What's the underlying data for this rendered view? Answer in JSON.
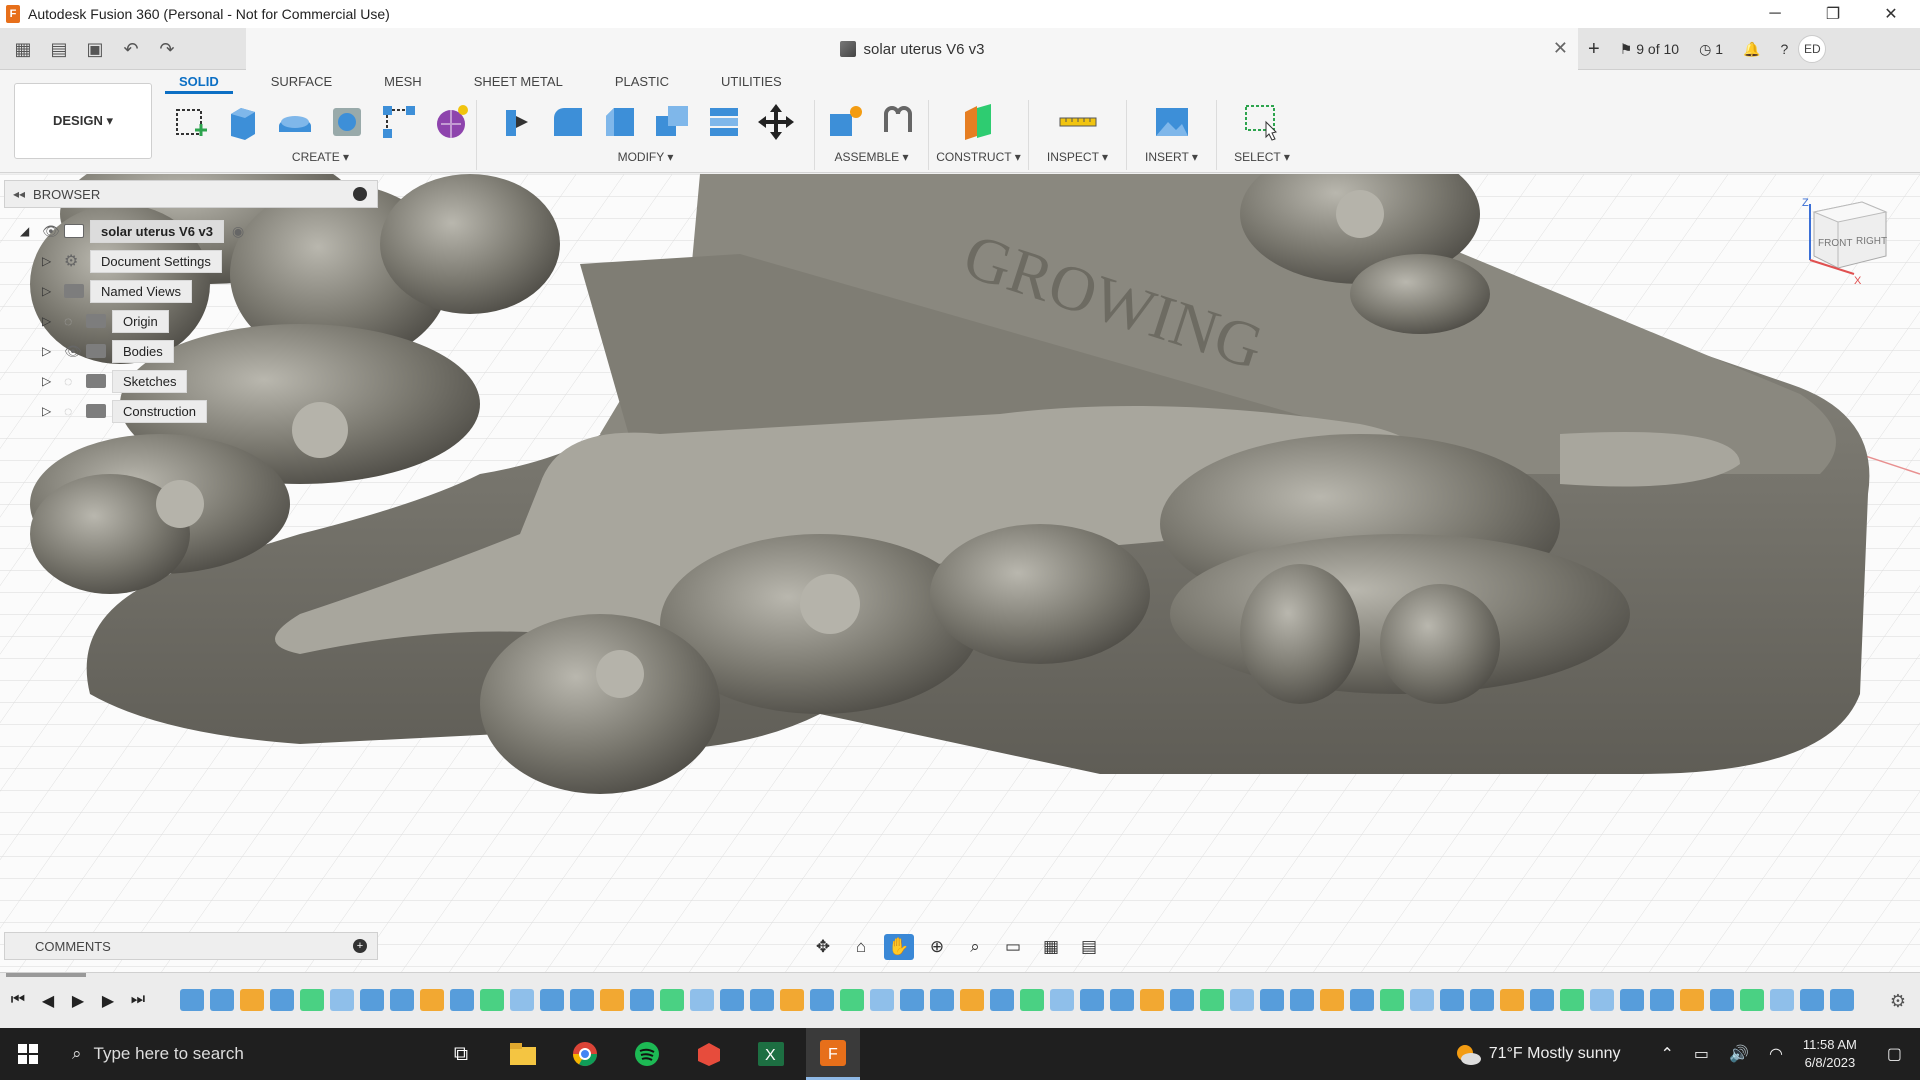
{
  "window": {
    "title": "Autodesk Fusion 360 (Personal - Not for Commercial Use)",
    "controls": [
      "─",
      "❐",
      "✕"
    ]
  },
  "quick_access": {
    "document_title": "solar uterus V6 v3",
    "version_label": "9 of 10",
    "jobs_count": "1",
    "user_initials": "ED"
  },
  "ribbon": {
    "workspace": "DESIGN ▾",
    "tabs": [
      "SOLID",
      "SURFACE",
      "MESH",
      "SHEET METAL",
      "PLASTIC",
      "UTILITIES"
    ],
    "active_tab": "SOLID",
    "groups": {
      "create": "CREATE ▾",
      "modify": "MODIFY ▾",
      "assemble": "ASSEMBLE ▾",
      "construct": "CONSTRUCT ▾",
      "inspect": "INSPECT ▾",
      "insert": "INSERT ▾",
      "select": "SELECT ▾"
    }
  },
  "browser": {
    "header": "BROWSER",
    "root": "solar uterus V6 v3",
    "items": [
      "Document Settings",
      "Named Views",
      "Origin",
      "Bodies",
      "Sketches",
      "Construction"
    ]
  },
  "comments": {
    "header": "COMMENTS"
  },
  "viewcube": {
    "faces": [
      "FRONT",
      "RIGHT"
    ],
    "axes": [
      "Z",
      "X"
    ]
  },
  "taskbar": {
    "search_placeholder": "Type here to search",
    "weather": "71°F  Mostly sunny",
    "time": "11:58 AM",
    "date": "6/8/2023"
  },
  "colors": {
    "accent": "#0c6fc4",
    "model": "#7a786f",
    "taskbar": "#1f1f1f"
  }
}
